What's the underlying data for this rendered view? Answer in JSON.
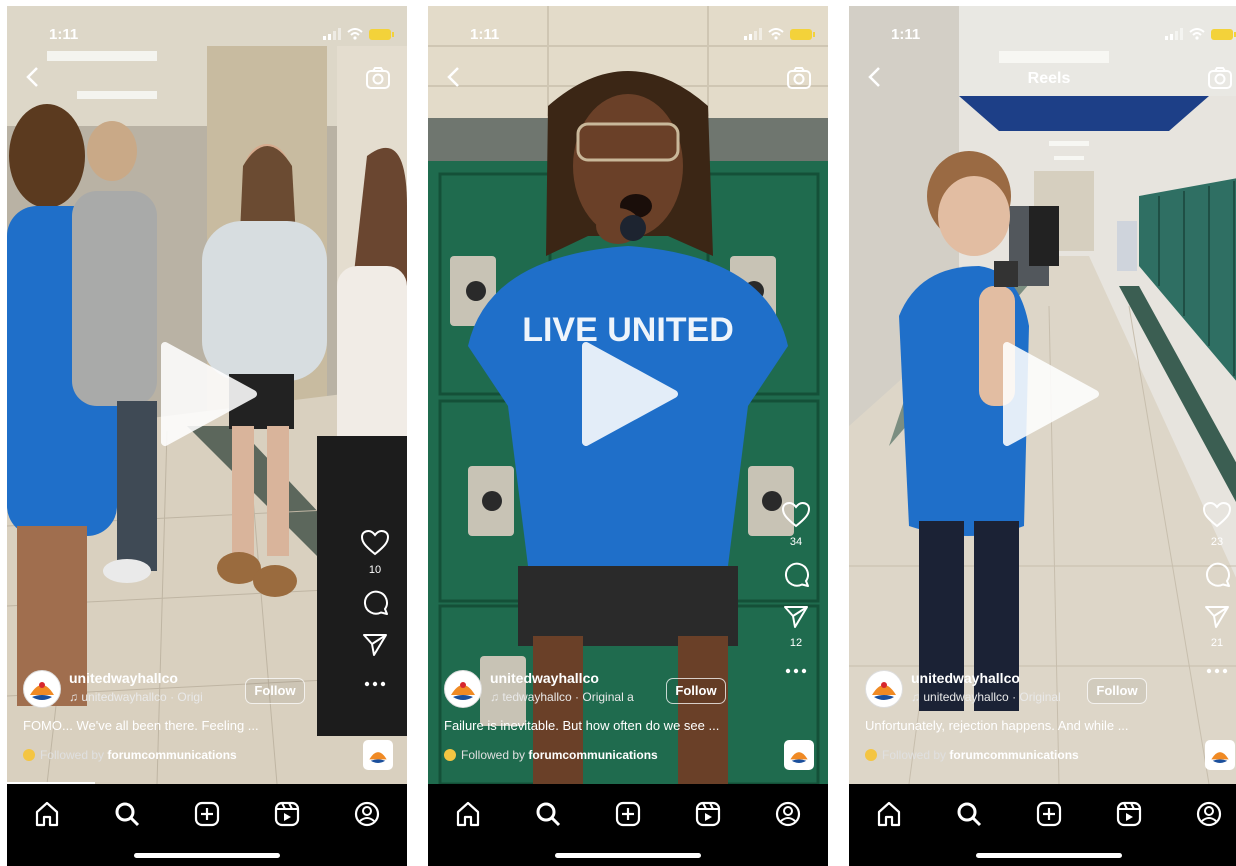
{
  "screens": [
    {
      "status": {
        "time": "1:11"
      },
      "header": {
        "title": ""
      },
      "likes": "10",
      "comments": "",
      "shares": "",
      "username": "unitedwayhallco",
      "audio": "unitedwayhallco · Origi",
      "follow_label": "Follow",
      "caption": "FOMO... We've all been there. Feeling ...",
      "followed_prefix": "Followed by",
      "followed_by": "forumcommunications",
      "progress_fraction": 0.22
    },
    {
      "status": {
        "time": "1:11"
      },
      "header": {
        "title": ""
      },
      "likes": "34",
      "comments": "",
      "shares": "12",
      "username": "unitedwayhallco",
      "audio": "tedwayhallco · Original a",
      "follow_label": "Follow",
      "caption": "Failure is inevitable. But how often do we see ...",
      "followed_prefix": "Followed by",
      "followed_by": "forumcommunications",
      "progress_fraction": 0
    },
    {
      "status": {
        "time": "1:11"
      },
      "header": {
        "title": "Reels"
      },
      "likes": "23",
      "comments": "",
      "shares": "21",
      "username": "unitedwayhallco",
      "audio": "unitedwayhallco · Original",
      "follow_label": "Follow",
      "caption": "Unfortunately, rejection happens. And while ...",
      "followed_prefix": "Followed by",
      "followed_by": "forumcommunications",
      "progress_fraction": 0
    }
  ],
  "shirt_text": "LIVE UNITED",
  "colors": {
    "shirt": "#1f6fc9",
    "locker": "#1f6b4e",
    "floor": "#d8cfbf",
    "badge": "#f4c542"
  },
  "icons": {
    "nav": [
      "home-icon",
      "search-icon",
      "create-icon",
      "reels-icon",
      "profile-icon"
    ],
    "rail": [
      "heart-icon",
      "comment-icon",
      "send-icon",
      "more-icon"
    ]
  }
}
